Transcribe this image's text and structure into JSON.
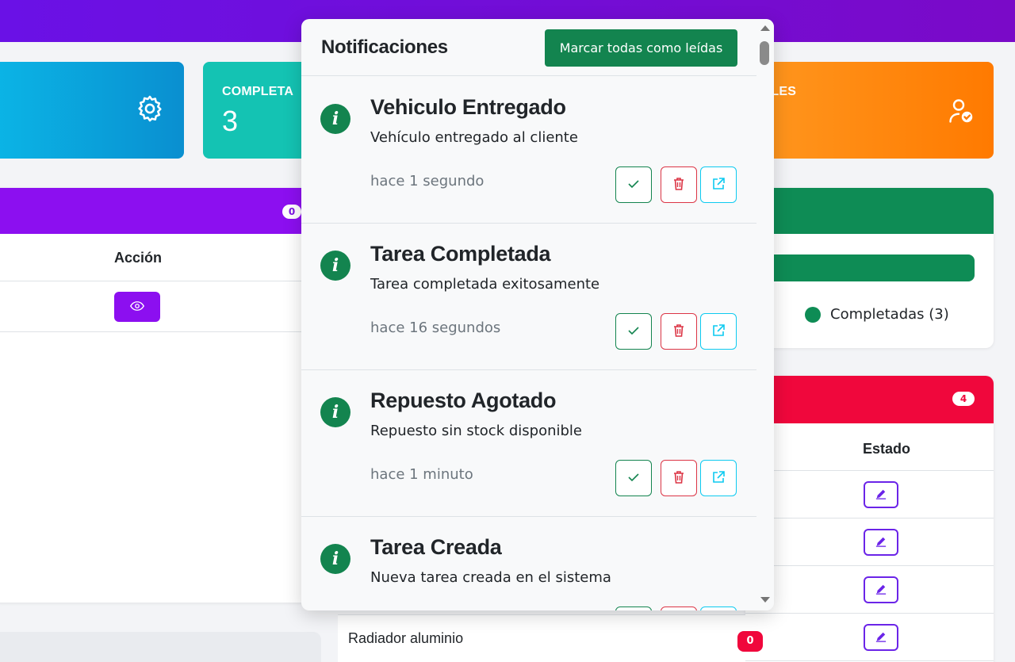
{
  "stats": {
    "completed": {
      "title": "COMPLETA",
      "value": "3"
    },
    "available": {
      "title": "IBLES"
    }
  },
  "left_card": {
    "badge": "0",
    "col_action": "Acción"
  },
  "progress_card": {
    "legend_label": "Completadas (3)"
  },
  "stock_card": {
    "badge": "4",
    "col_status": "Estado",
    "last_item_name": "Radiador aluminio",
    "last_item_stock": "0"
  },
  "notifications": {
    "title": "Notificaciones",
    "mark_all_label": "Marcar todas como leídas",
    "items": [
      {
        "title": "Vehiculo Entregado",
        "message": "Vehículo entregado al cliente",
        "time": "hace 1 segundo"
      },
      {
        "title": "Tarea Completada",
        "message": "Tarea completada exitosamente",
        "time": "hace 16 segundos"
      },
      {
        "title": "Repuesto Agotado",
        "message": "Repuesto sin stock disponible",
        "time": "hace 1 minuto"
      },
      {
        "title": "Tarea Creada",
        "message": "Nueva tarea creada en el sistema",
        "time": ""
      }
    ]
  },
  "colors": {
    "header": "#6a11e6",
    "success": "#13844f",
    "danger": "#f0073c",
    "info": "#0dcaf0",
    "purple_card": "#8c0ff0",
    "orange_card": "#ff7a00"
  },
  "icons": [
    "gear-icon",
    "user-check-icon",
    "eye-icon",
    "info-icon",
    "check-icon",
    "trash-icon",
    "external-link-icon",
    "edit-icon"
  ]
}
